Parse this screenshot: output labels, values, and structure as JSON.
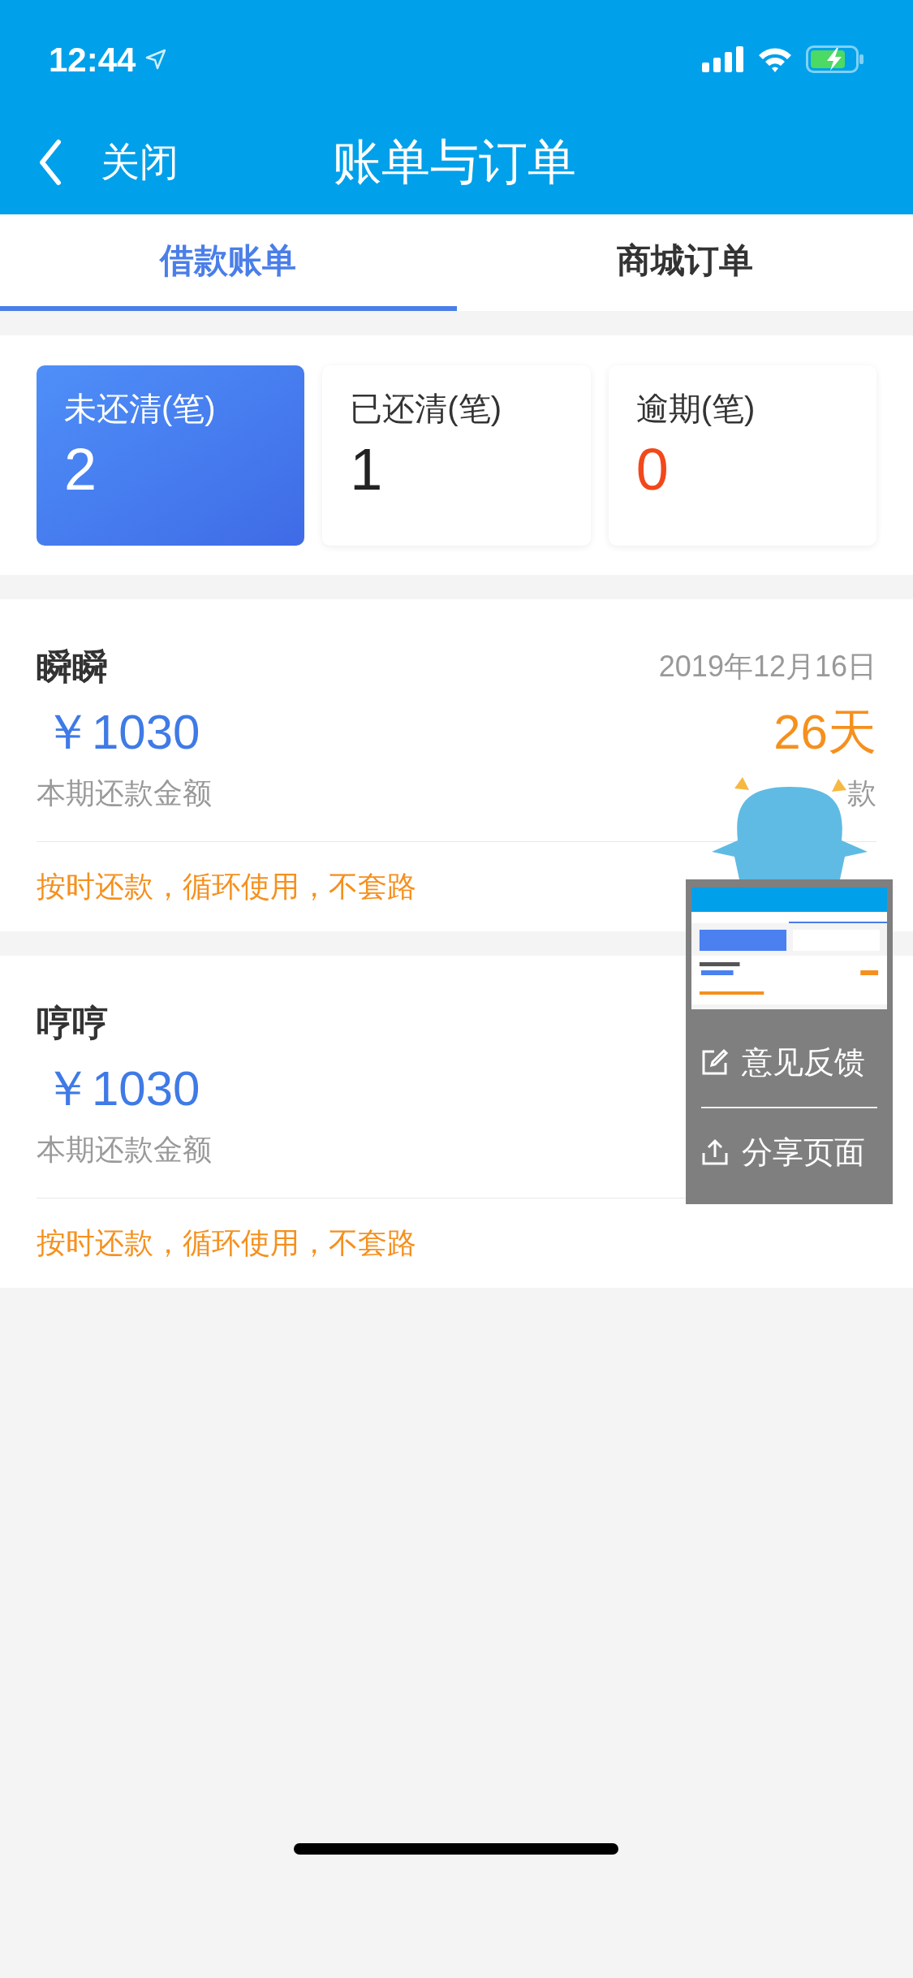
{
  "status_bar": {
    "time": "12:44"
  },
  "nav": {
    "close_label": "关闭",
    "title": "账单与订单"
  },
  "tabs": [
    {
      "label": "借款账单",
      "selected": true
    },
    {
      "label": "商城订单",
      "selected": false
    }
  ],
  "stats": [
    {
      "label": "未还清(笔)",
      "value": "2",
      "selected": true,
      "kind": "normal"
    },
    {
      "label": "已还清(笔)",
      "value": "1",
      "selected": false,
      "kind": "normal"
    },
    {
      "label": "逾期(笔)",
      "value": "0",
      "selected": false,
      "kind": "overdue"
    }
  ],
  "bills": [
    {
      "name": "瞬瞬",
      "date": "2019年12月16日",
      "amount": "￥1030",
      "amount_label": "本期还款金额",
      "days": "26天",
      "days_label": "款",
      "slogan": "按时还款，循环使用，不套路"
    },
    {
      "name": "哼哼",
      "amount": "￥1030",
      "amount_label": "本期还款金额",
      "slogan": "按时还款，循环使用，不套路"
    }
  ],
  "float_menu": {
    "items": [
      {
        "kind": "feedback",
        "label": "意见反馈"
      },
      {
        "kind": "share",
        "label": "分享页面"
      }
    ]
  }
}
